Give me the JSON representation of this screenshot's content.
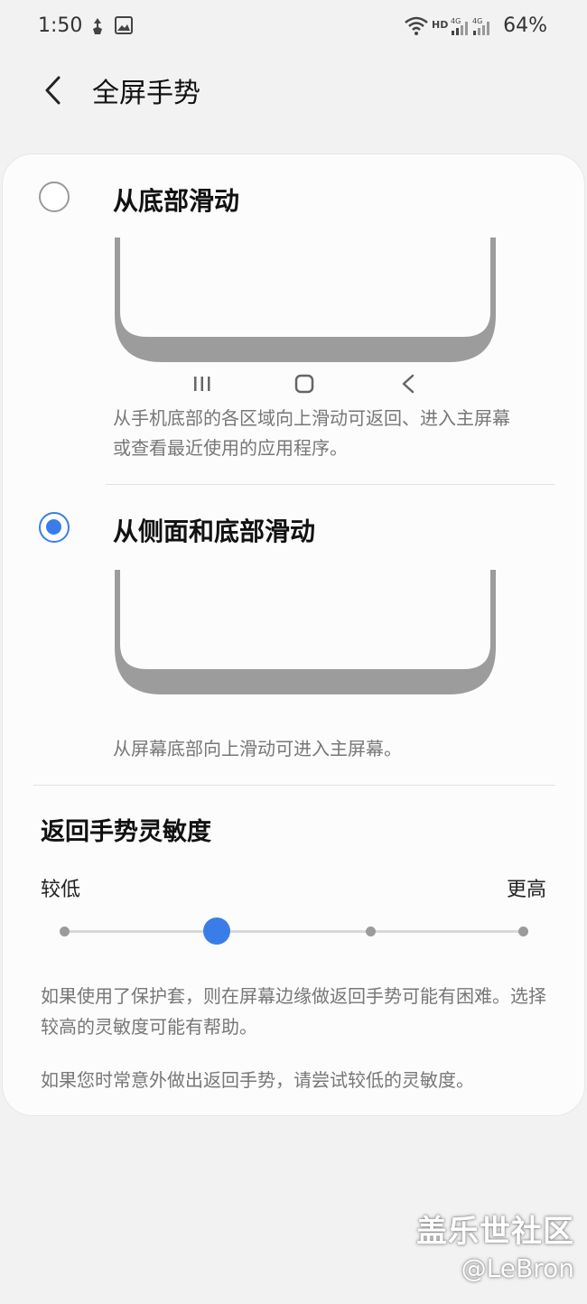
{
  "status_bar": {
    "time": "1:50",
    "battery": "64%",
    "icons": [
      "navigation-app-icon",
      "gallery-icon",
      "wifi-icon",
      "hd-icon",
      "signal-4g-icon",
      "signal-4g-icon"
    ]
  },
  "header": {
    "title": "全屏手势",
    "back_icon": "chevron-left-icon"
  },
  "options": [
    {
      "title": "从底部滑动",
      "selected": false,
      "description": "从手机底部的各区域向上滑动可返回、进入主屏幕或查看最近使用的应用程序。",
      "illustration": "phone-bottom-with-nav-buttons"
    },
    {
      "title": "从侧面和底部滑动",
      "selected": true,
      "description": "从屏幕底部向上滑动可进入主屏幕。",
      "illustration": "phone-bottom-no-nav-buttons"
    }
  ],
  "sensitivity": {
    "title": "返回手势灵敏度",
    "low_label": "较低",
    "high_label": "更高",
    "steps": 4,
    "current_step": 2,
    "accent": "#3b7de8"
  },
  "help": {
    "line1": "如果使用了保护套，则在屏幕边缘做返回手势可能有困难。选择较高的灵敏度可能有帮助。",
    "line2": "如果您时常意外做出返回手势，请尝试较低的灵敏度。"
  },
  "watermark": {
    "brand": "盖乐世社区",
    "user": "@LeBron"
  }
}
